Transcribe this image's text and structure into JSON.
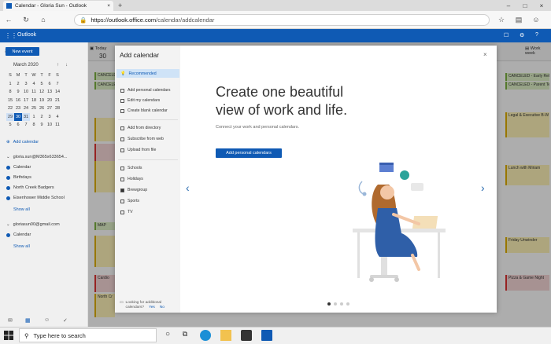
{
  "browser": {
    "tab_title": "Calendar - Gloria Sun - Outlook",
    "new_tab": "+",
    "url_domain": "https://outlook.office.com",
    "url_path": "/calendar/addcalendar"
  },
  "outlook": {
    "app_name": "Outlook",
    "new_event": "New event",
    "today": "Today",
    "day_number": "30",
    "work_week": "Work week"
  },
  "mini_calendar": {
    "month": "March 2020",
    "days_header": [
      "S",
      "M",
      "T",
      "W",
      "T",
      "F",
      "S"
    ],
    "weeks": [
      [
        "1",
        "2",
        "3",
        "4",
        "5",
        "6",
        "7"
      ],
      [
        "8",
        "9",
        "10",
        "11",
        "12",
        "13",
        "14"
      ],
      [
        "15",
        "16",
        "17",
        "18",
        "19",
        "20",
        "21"
      ],
      [
        "22",
        "23",
        "24",
        "25",
        "26",
        "27",
        "28"
      ],
      [
        "29",
        "30",
        "31",
        "1",
        "2",
        "3",
        "4"
      ],
      [
        "5",
        "6",
        "7",
        "8",
        "9",
        "10",
        "11"
      ]
    ]
  },
  "left_nav": {
    "add_calendar": "Add calendar",
    "account1": "gloria.sun@M365x633654...",
    "cal1": [
      "Calendar",
      "Birthdays",
      "North Creek Badgers",
      "Eisenhower Middle School"
    ],
    "show_all": "Show all",
    "account2": "gloriasun00@gmail.com",
    "cal2": [
      "Calendar"
    ],
    "show_all_2": "Show all"
  },
  "modal": {
    "title": "Add calendar",
    "recommended": "Recommended",
    "group1": [
      "Add personal calendars",
      "Edit my calendars",
      "Create blank calendar"
    ],
    "group2": [
      "Add from directory",
      "Subscribe from web",
      "Upload from file"
    ],
    "group3": [
      "Schools",
      "Holidays",
      "Brewgroup",
      "Sports",
      "TV"
    ],
    "footer_question": "Looking for additional calendars?",
    "footer_yes": "Yes",
    "footer_no": "No",
    "close": "×",
    "headline": "Create one beautiful view of work and life.",
    "subline": "Connect your work and personal calendars.",
    "cta": "Add personal calendars",
    "prev": "‹",
    "next": "›"
  },
  "events_right": [
    "CANCELED - Early Rele",
    "CANCELED - Parent Tea",
    "Legal & Executive B-W",
    "Lunch with Miriam",
    "Friday Unwinder",
    "Pizza & Game Night"
  ],
  "events_left": [
    "CANCELED",
    "CANCELED",
    "MAP",
    "Cardio",
    "North Cr"
  ],
  "taskbar": {
    "search_placeholder": "Type here to search"
  },
  "colors": {
    "brand": "#0f5ab4",
    "event_green": "#dff0c8",
    "event_yellow": "#fff4b8",
    "event_pink": "#f7d7d7"
  }
}
